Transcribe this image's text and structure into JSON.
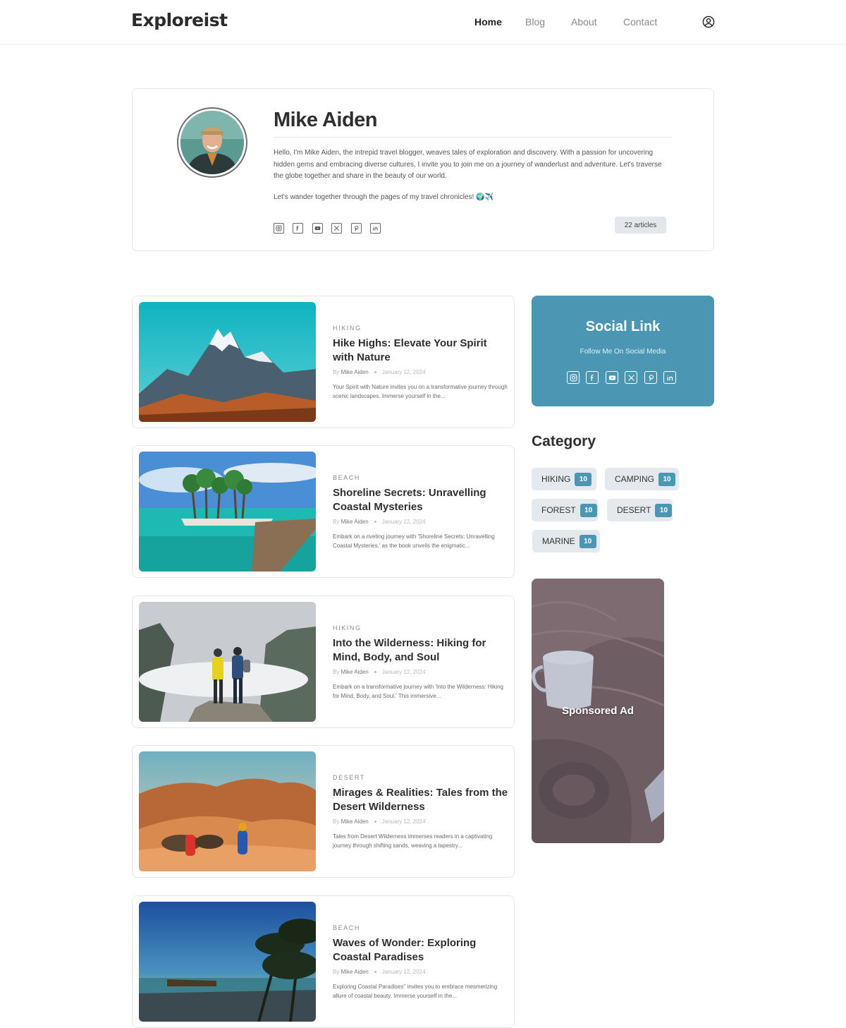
{
  "brand": {
    "name": "Exploreist"
  },
  "nav": {
    "items": [
      {
        "label": "Home",
        "active": true
      },
      {
        "label": "Blog",
        "active": false
      },
      {
        "label": "About",
        "active": false
      },
      {
        "label": "Contact",
        "active": false
      }
    ],
    "user_icon": "user-circle-icon"
  },
  "author": {
    "name": "Mike Aiden",
    "bio": "Hello, I'm Mike Aiden, the intrepid travel blogger, weaves tales of exploration and discovery. With a passion for uncovering hidden gems and embracing diverse cultures, I invite you to join me on a journey of wanderlust and adventure. Let's traverse the globe together and share in the beauty of our world.",
    "tagline": "Let's wander together through the pages of my travel chronicles! 🌍✈️",
    "articles_label": "22 articles",
    "social_icons": [
      "instagram-icon",
      "facebook-icon",
      "youtube-icon",
      "x-icon",
      "pinterest-icon",
      "linkedin-icon"
    ]
  },
  "posts": [
    {
      "category": "HIKING",
      "title": "Hike Highs: Elevate Your Spirit with Nature",
      "by": "By",
      "author": "Mike Aiden",
      "date": "January 12, 2024",
      "excerpt": "Your Spirit with Nature invites you on a transformative journey through scenic landscapes. Immerse yourself in the..."
    },
    {
      "category": "BEACH",
      "title": "Shoreline Secrets: Unravelling Coastal Mysteries",
      "by": "By",
      "author": "Mike Aiden",
      "date": "January 12, 2024",
      "excerpt": "Embark on a riveting journey with 'Shoreline Secrets: Unravelling Coastal Mysteries,' as the book unveils the enigmatic..."
    },
    {
      "category": "HIKING",
      "title": "Into the Wilderness: Hiking for Mind, Body, and Soul",
      "by": "By",
      "author": "Mike Aiden",
      "date": "January 12, 2024",
      "excerpt": "Embark on a transformative journey with 'Into the Wilderness: Hiking for Mind, Body, and Soul.' This immersive..."
    },
    {
      "category": "DESERT",
      "title": "Mirages & Realities: Tales from the Desert Wilderness",
      "by": "By",
      "author": "Mike Aiden",
      "date": "January 12, 2024",
      "excerpt": "Tales from Desert Wilderness immerses readers in a captivating journey through shifting sands, weaving a tapestry..."
    },
    {
      "category": "BEACH",
      "title": "Waves of Wonder: Exploring Coastal Paradises",
      "by": "By",
      "author": "Mike Aiden",
      "date": "January 12, 2024",
      "excerpt": "Exploring Coastal Paradises\" invites you to embrace mesmerizing allure of coastal beauty. Immerse yourself in the..."
    }
  ],
  "sidebar": {
    "social": {
      "title": "Social Link",
      "subtitle": "Follow Me On Social Media"
    },
    "category": {
      "title": "Category",
      "items": [
        {
          "label": "HIKING",
          "count": "10"
        },
        {
          "label": "CAMPING",
          "count": "10"
        },
        {
          "label": "FOREST",
          "count": "10"
        },
        {
          "label": "DESERT",
          "count": "10"
        },
        {
          "label": "MARINE",
          "count": "10"
        }
      ]
    },
    "ad": {
      "label": "Sponsored Ad"
    }
  },
  "colors": {
    "accent": "#4b97b3",
    "chip_bg": "#e3e9ec",
    "badge_bg": "#e1e7eb"
  }
}
